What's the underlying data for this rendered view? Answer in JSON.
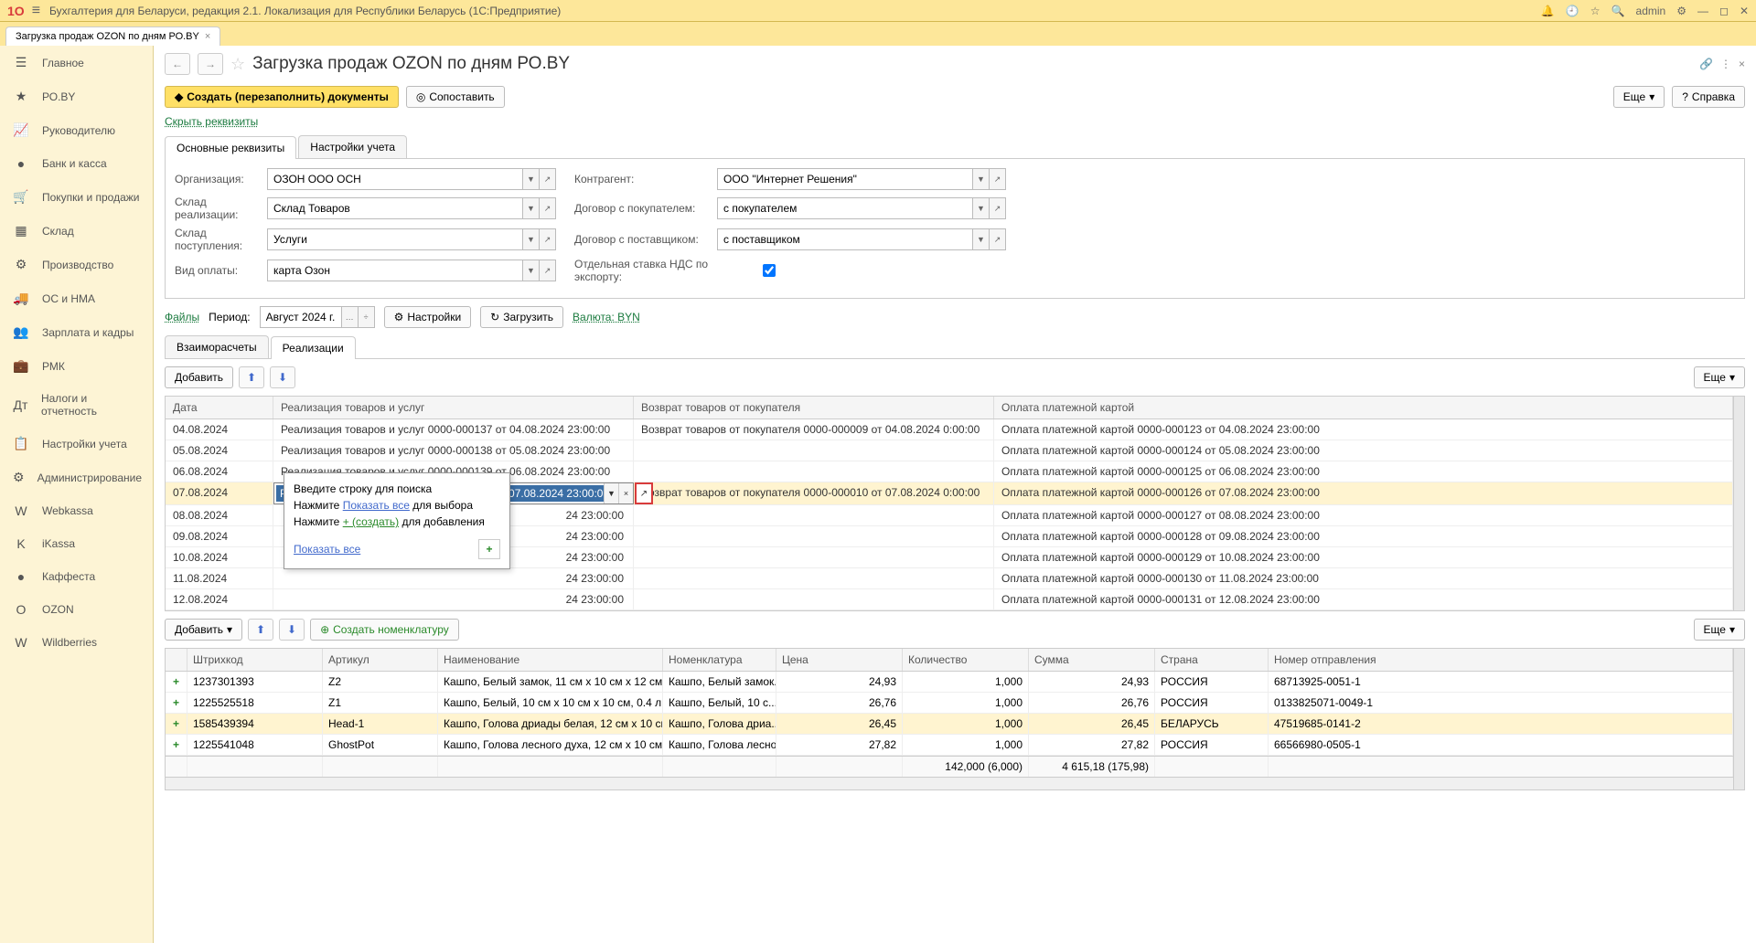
{
  "titlebar": {
    "logo": "1О",
    "title": "Бухгалтерия для Беларуси, редакция 2.1. Локализация для Республики Беларусь  (1С:Предприятие)",
    "user": "admin"
  },
  "tab": {
    "label": "Загрузка продаж OZON по дням РО.BY"
  },
  "sidebar": [
    {
      "icon": "☰",
      "label": "Главное"
    },
    {
      "icon": "★",
      "label": "РО.BY"
    },
    {
      "icon": "📈",
      "label": "Руководителю"
    },
    {
      "icon": "●",
      "label": "Банк и касса"
    },
    {
      "icon": "🛒",
      "label": "Покупки и продажи"
    },
    {
      "icon": "▦",
      "label": "Склад"
    },
    {
      "icon": "⚙",
      "label": "Производство"
    },
    {
      "icon": "🚚",
      "label": "ОС и НМА"
    },
    {
      "icon": "👥",
      "label": "Зарплата и кадры"
    },
    {
      "icon": "💼",
      "label": "РМК"
    },
    {
      "icon": "Дт",
      "label": "Налоги и отчетность"
    },
    {
      "icon": "📋",
      "label": "Настройки учета"
    },
    {
      "icon": "⚙",
      "label": "Администрирование"
    },
    {
      "icon": "W",
      "label": "Webkassa"
    },
    {
      "icon": "K",
      "label": "iKassa"
    },
    {
      "icon": "●",
      "label": "Каффеста"
    },
    {
      "icon": "O",
      "label": "OZON"
    },
    {
      "icon": "W",
      "label": "Wildberries"
    }
  ],
  "page": {
    "title": "Загрузка продаж OZON по дням РО.BY",
    "btn_create": "Создать (перезаполнить) документы",
    "btn_compare": "Сопоставить",
    "btn_more": "Еще",
    "btn_help": "Справка",
    "link_hide": "Скрыть реквизиты"
  },
  "subtabs": {
    "t1": "Основные реквизиты",
    "t2": "Настройки учета"
  },
  "form": {
    "l_org": "Организация:",
    "v_org": "ОЗОН ООО ОСН",
    "l_contr": "Контрагент:",
    "v_contr": "ООО \"Интернет Решения\"",
    "l_whs": "Склад реализации:",
    "v_whs": "Склад Товаров",
    "l_dog_cust": "Договор с покупателем:",
    "v_dog_cust": "с покупателем",
    "l_whp": "Склад поступления:",
    "v_whp": "Услуги",
    "l_dog_supp": "Договор с поставщиком:",
    "v_dog_supp": "с поставщиком",
    "l_pay": "Вид оплаты:",
    "v_pay": "карта Озон",
    "l_nds": "Отдельная ставка НДС по экспорту:"
  },
  "period": {
    "l_files": "Файлы",
    "l_period": "Период:",
    "v_period": "Август 2024 г.",
    "btn_settings": "Настройки",
    "btn_load": "Загрузить",
    "l_cur": "Валюта: BYN"
  },
  "tabs2": {
    "t1": "Взаиморасчеты",
    "t2": "Реализации"
  },
  "gridtb": {
    "btn_add": "Добавить",
    "btn_more": "Еще"
  },
  "grid": {
    "h_date": "Дата",
    "h_real": "Реализация товаров и услуг",
    "h_ret": "Возврат товаров от покупателя",
    "h_pay": "Оплата платежной картой",
    "rows": [
      {
        "date": "04.08.2024",
        "real": "Реализация товаров и услуг 0000-000137 от 04.08.2024 23:00:00",
        "ret": "Возврат товаров от покупателя 0000-000009 от 04.08.2024 0:00:00",
        "pay": "Оплата платежной картой 0000-000123 от 04.08.2024 23:00:00"
      },
      {
        "date": "05.08.2024",
        "real": "Реализация товаров и услуг 0000-000138 от 05.08.2024 23:00:00",
        "ret": "",
        "pay": "Оплата платежной картой 0000-000124 от 05.08.2024 23:00:00"
      },
      {
        "date": "06.08.2024",
        "real": "Реализация товаров и услуг 0000-000139 от 06.08.2024 23:00:00",
        "ret": "",
        "pay": "Оплата платежной картой 0000-000125 от 06.08.2024 23:00:00"
      },
      {
        "date": "07.08.2024",
        "real": "Реализация товаров и услуг 0000-000140 от 07.08.2024 23:00:00",
        "ret": "Возврат товаров от покупателя 0000-000010 от 07.08.2024 0:00:00",
        "pay": "Оплата платежной картой 0000-000126 от 07.08.2024 23:00:00"
      },
      {
        "date": "08.08.2024",
        "real": "24 23:00:00",
        "ret": "",
        "pay": "Оплата платежной картой 0000-000127 от 08.08.2024 23:00:00"
      },
      {
        "date": "09.08.2024",
        "real": "24 23:00:00",
        "ret": "",
        "pay": "Оплата платежной картой 0000-000128 от 09.08.2024 23:00:00"
      },
      {
        "date": "10.08.2024",
        "real": "24 23:00:00",
        "ret": "",
        "pay": "Оплата платежной картой 0000-000129 от 10.08.2024 23:00:00"
      },
      {
        "date": "11.08.2024",
        "real": "24 23:00:00",
        "ret": "",
        "pay": "Оплата платежной картой 0000-000130 от 11.08.2024 23:00:00"
      },
      {
        "date": "12.08.2024",
        "real": "24 23:00:00",
        "ret": "",
        "pay": "Оплата платежной картой 0000-000131 от 12.08.2024 23:00:00"
      }
    ]
  },
  "popup": {
    "l1": "Введите строку для поиска",
    "l2a": "Нажмите ",
    "l2link": "Показать все",
    "l2b": " для выбора",
    "l3a": "Нажмите ",
    "l3link": "+ (создать)",
    "l3b": " для добавления",
    "footer_link": "Показать все"
  },
  "gridtb2": {
    "btn_add": "Добавить",
    "btn_create_nom": "Создать номенклатуру",
    "btn_more": "Еще"
  },
  "bgrid": {
    "h_bar": "Штрихкод",
    "h_art": "Артикул",
    "h_name": "Наименование",
    "h_nom": "Номенклатура",
    "h_price": "Цена",
    "h_qty": "Количество",
    "h_sum": "Сумма",
    "h_ctry": "Страна",
    "h_ship": "Номер отправления",
    "rows": [
      {
        "bar": "1237301393",
        "art": "Z2",
        "name": "Кашпо, Белый замок, 11 см х 10 см х 12 см, 0...",
        "nom": "Кашпо, Белый замок...",
        "price": "24,93",
        "qty": "1,000",
        "sum": "24,93",
        "ctry": "РОССИЯ",
        "ship": "68713925-0051-1"
      },
      {
        "bar": "1225525518",
        "art": "Z1",
        "name": "Кашпо, Белый, 10 см х 10 см х 10 см, 0.4 л, 1...",
        "nom": "Кашпо, Белый, 10 с...",
        "price": "26,76",
        "qty": "1,000",
        "sum": "26,76",
        "ctry": "РОССИЯ",
        "ship": "0133825071-0049-1"
      },
      {
        "bar": "1585439394",
        "art": "Head-1",
        "name": "Кашпо, Голова дриады белая, 12 см х 10 см х ...",
        "nom": "Кашпо, Голова дриа...",
        "price": "26,45",
        "qty": "1,000",
        "sum": "26,45",
        "ctry": "БЕЛАРУСЬ",
        "ship": "47519685-0141-2"
      },
      {
        "bar": "1225541048",
        "art": "GhostPot",
        "name": "Кашпо, Голова лесного духа, 12 см х 10 см х ...",
        "nom": "Кашпо, Голова лесно...",
        "price": "27,82",
        "qty": "1,000",
        "sum": "27,82",
        "ctry": "РОССИЯ",
        "ship": "66566980-0505-1"
      }
    ],
    "total": {
      "qty": "142,000 (6,000)",
      "sum": "4 615,18 (175,98)"
    }
  }
}
